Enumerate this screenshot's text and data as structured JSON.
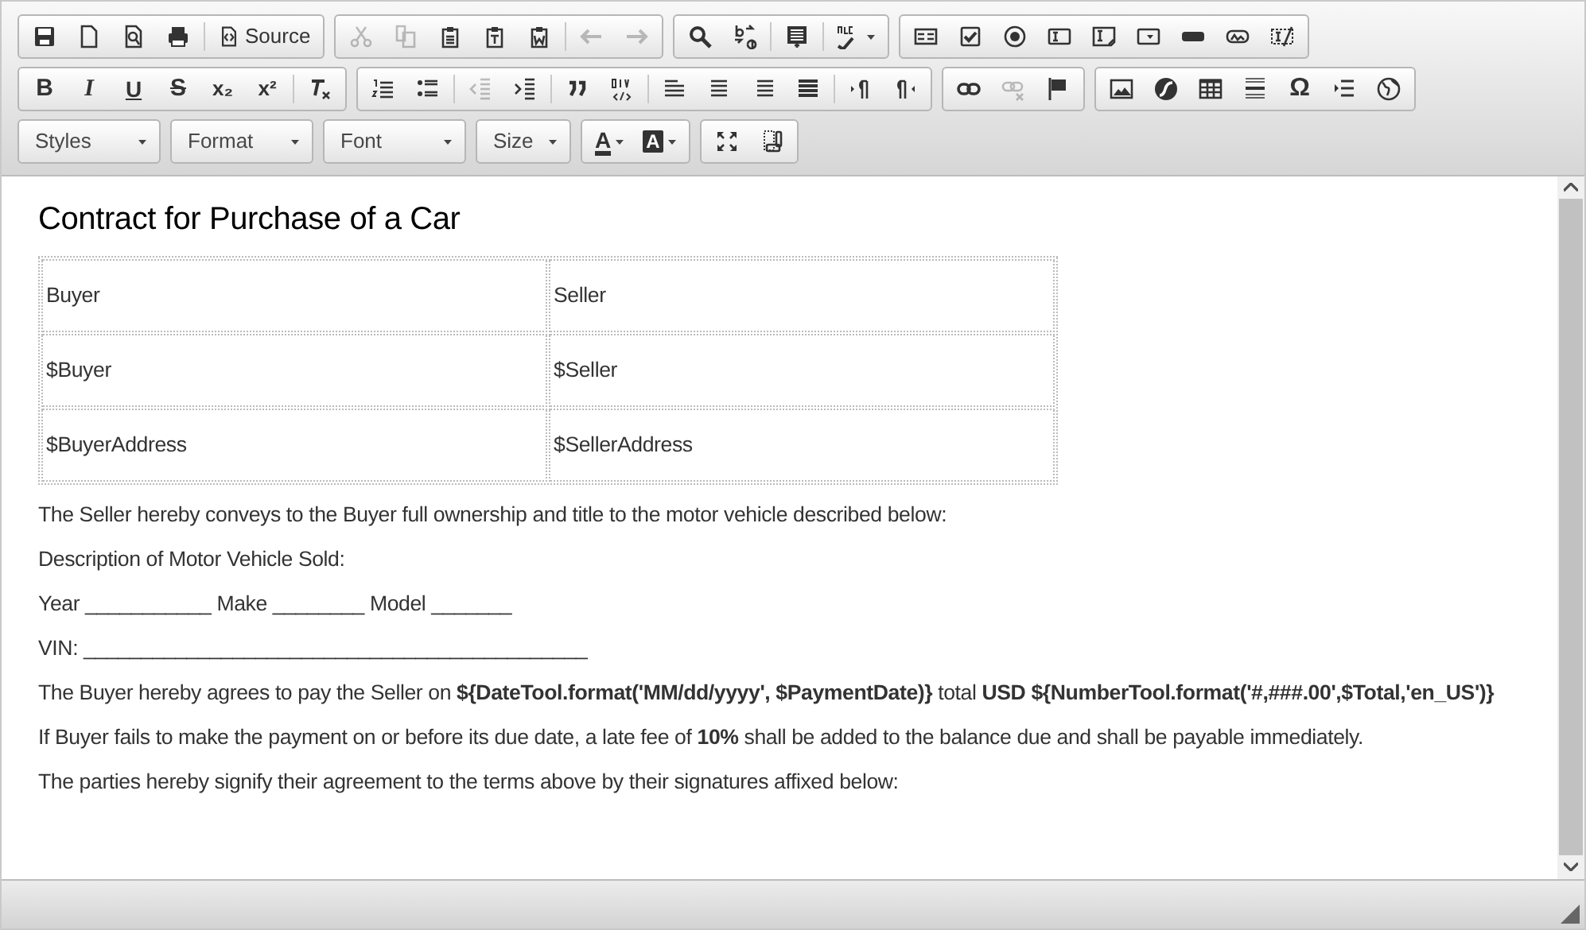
{
  "toolbar_rows": [
    {
      "groups": [
        {
          "sections": [
            [
              {
                "disabled": false
              },
              {
                "disabled": false
              },
              {
                "disabled": false
              },
              {
                "disabled": false
              }
            ],
            [
              {
                "disabled": false,
                "label": "Source"
              }
            ]
          ]
        },
        {
          "sections": [
            [
              {
                "disabled": true
              },
              {
                "disabled": true
              },
              {
                "disabled": false
              },
              {
                "disabled": false
              },
              {
                "disabled": false
              }
            ],
            [
              {
                "disabled": true
              },
              {
                "disabled": true
              }
            ]
          ]
        },
        {
          "sections": [
            [
              {
                "disabled": false
              },
              {
                "disabled": false
              }
            ],
            [
              {
                "disabled": false
              }
            ],
            [
              {
                "disabled": false,
                "dropdown": true
              }
            ]
          ]
        },
        {
          "sections": [
            [
              {
                "disabled": false
              },
              {
                "disabled": false
              },
              {
                "disabled": false
              },
              {
                "disabled": false
              },
              {
                "disabled": false
              },
              {
                "disabled": false
              },
              {
                "disabled": false
              },
              {
                "disabled": false
              },
              {
                "disabled": false
              }
            ]
          ]
        }
      ]
    },
    {
      "groups": [
        {
          "sections": [
            [
              {
                "disabled": false,
                "glyph": "B"
              },
              {
                "disabled": false,
                "glyph": "I"
              },
              {
                "disabled": false,
                "glyph": "U"
              },
              {
                "disabled": false,
                "glyph": "S"
              },
              {
                "disabled": false,
                "glyph": "x₂"
              },
              {
                "disabled": false,
                "glyph": "x²"
              }
            ],
            [
              {
                "disabled": false
              }
            ]
          ]
        },
        {
          "sections": [
            [
              {
                "disabled": false
              },
              {
                "disabled": false
              }
            ],
            [
              {
                "disabled": true
              },
              {
                "disabled": false
              }
            ],
            [
              {
                "disabled": false
              },
              {
                "disabled": false
              }
            ],
            [
              {
                "disabled": false
              },
              {
                "disabled": false
              },
              {
                "disabled": false
              },
              {
                "disabled": false
              }
            ],
            [
              {
                "disabled": false
              },
              {
                "disabled": false
              }
            ]
          ]
        },
        {
          "sections": [
            [
              {
                "disabled": false
              },
              {
                "disabled": true
              },
              {
                "disabled": false
              }
            ]
          ]
        },
        {
          "sections": [
            [
              {
                "disabled": false
              },
              {
                "disabled": false
              },
              {
                "disabled": false
              },
              {
                "disabled": false
              },
              {
                "disabled": false,
                "glyph": "Ω"
              },
              {
                "disabled": false
              },
              {
                "disabled": false
              }
            ]
          ]
        }
      ]
    },
    {
      "combos": [
        {
          "label": "Styles"
        },
        {
          "label": "Format"
        },
        {
          "label": "Font"
        },
        {
          "label": "Size"
        }
      ],
      "groups": [
        {
          "sections": [
            [
              {
                "disabled": false,
                "glyph": "A",
                "dropdown": true
              },
              {
                "disabled": false,
                "glyph": "A",
                "dropdown": true
              }
            ]
          ]
        },
        {
          "sections": [
            [
              {
                "disabled": false
              },
              {
                "disabled": false
              }
            ]
          ]
        }
      ]
    }
  ],
  "document": {
    "title": "Contract for Purchase of a Car",
    "table": {
      "rows": [
        [
          "Buyer",
          "Seller"
        ],
        [
          "$Buyer",
          "$Seller"
        ],
        [
          "$BuyerAddress",
          "$SellerAddress"
        ]
      ]
    },
    "paragraphs": [
      "The Seller hereby conveys to the Buyer full ownership and title to the motor vehicle described below:",
      "Description of Motor Vehicle Sold:",
      "Year ___________ Make ________ Model _______",
      "VIN: ____________________________________________",
      "The Buyer hereby agrees to pay the Seller on **${DateTool.format('MM/dd/yyyy', $PaymentDate)}** total **USD ${NumberTool.format('#,###.00',$Total,'en_US')}**",
      "If Buyer fails to make the payment on or before its due date, a late fee of **10%** shall be added to the balance due and shall be payable immediately.",
      "The parties hereby signify their agreement to the terms above by their signatures affixed below:"
    ]
  }
}
